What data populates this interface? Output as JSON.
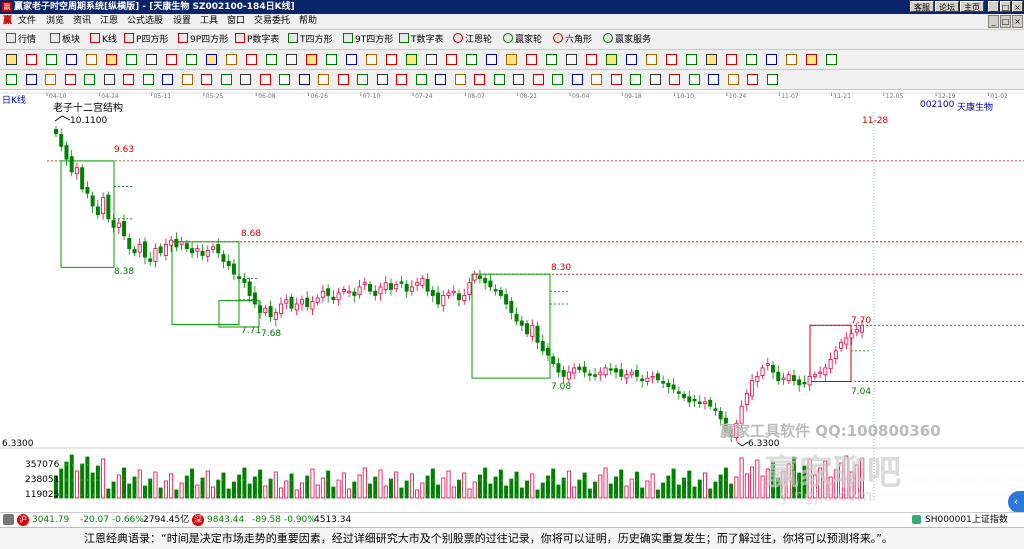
{
  "window": {
    "title": "赢家老子时空周期系统[纵横版] - [天康生物  SZ002100-184日K线]",
    "buttons": [
      "客服",
      "论坛",
      "主页"
    ],
    "controls": [
      "_",
      "□",
      "×"
    ]
  },
  "menu": [
    "文件",
    "浏览",
    "资讯",
    "江恩",
    "公式选股",
    "设置",
    "工具",
    "窗口",
    "交易委托",
    "帮助"
  ],
  "toolbar1": [
    "行情",
    "板块",
    "K线",
    "P四方形",
    "9P四方形",
    "P数字表",
    "T四方形",
    "9T四方形",
    "T数字表",
    "江恩轮",
    "赢家轮",
    "六角形",
    "赢家服务"
  ],
  "chart": {
    "period_label": "日K线",
    "indicator_title": "老子十二宫结构",
    "stock_code": "002100",
    "stock_name": "天康生物",
    "date_ticks": [
      "04-10",
      "04-24",
      "05-11",
      "05-25",
      "06-08",
      "06-26",
      "07-10",
      "07-24",
      "08-07",
      "08-21",
      "09-04",
      "09-18",
      "10-10",
      "10-24",
      "11-07",
      "11-21",
      "12-05",
      "12-19",
      "01-02"
    ],
    "cursor_date": "11-28",
    "high_label": "10.1100",
    "low_label": "6.3300",
    "level_labels": [
      "9.63",
      "8.38",
      "8.68",
      "7.71",
      "7.68",
      "8.30",
      "7.08",
      "7.70",
      "7.04"
    ],
    "volume_scale": [
      "6.3300",
      "357076",
      "238051",
      "119025"
    ],
    "watermark": {
      "line1": "赢家工具软件  QQ:100800360",
      "line2": "赢家聊吧",
      "line3": "yingjia.com"
    }
  },
  "status": {
    "sh_index": "3041.79",
    "sh_change": "-20.07",
    "sh_pct": "-0.66%",
    "sh_amount": "2794.45亿",
    "sz_index": "9843.44",
    "sz_change": "-89.58",
    "sz_pct": "-0.90%",
    "sz_amount": "4513.34",
    "right_text": "SH000001上证指数"
  },
  "quote": "江恩经典语录：“时间是决定市场走势的重要因素，经过详细研究大市及个别股票的过往记录，你将可以证明，历史确实重复发生；而了解过往，你将可以预测将来。”。",
  "colors": {
    "up": "#e0004a",
    "down": "#008000",
    "box_green": "#00a000",
    "box_red": "#e00000",
    "title_bg": "#0a246a"
  }
}
